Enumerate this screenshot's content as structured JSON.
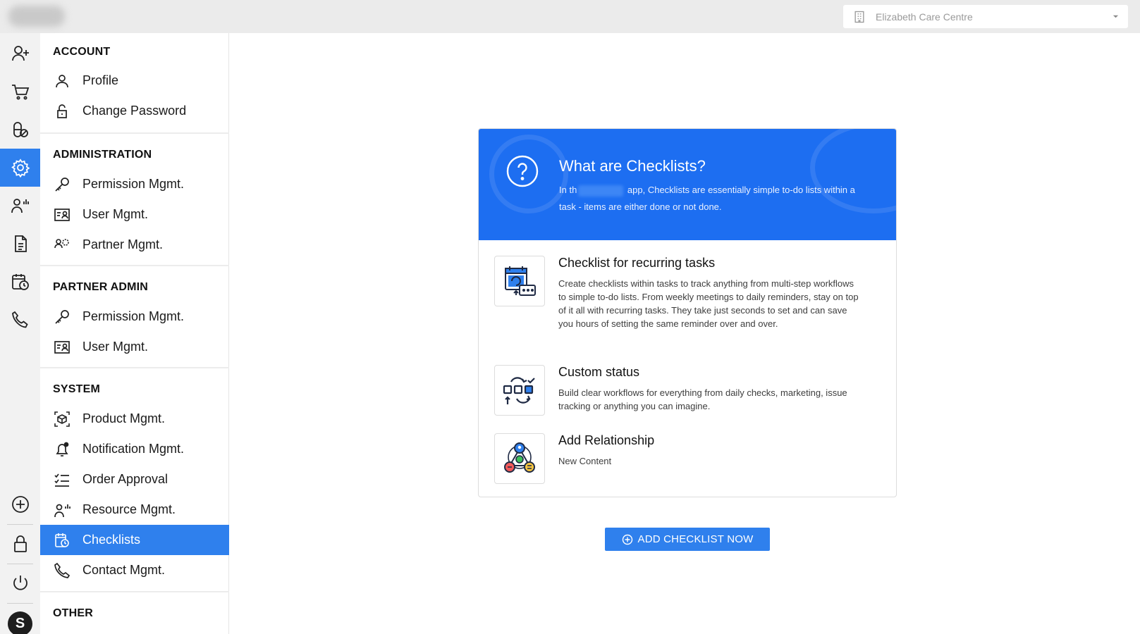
{
  "header": {
    "facility_name": "Elizabeth Care Centre",
    "facility_icon": "building-icon",
    "dropdown_icon": "caret-down-icon"
  },
  "rail": {
    "items": [
      "add-user-icon",
      "cart-icon",
      "medication-icon",
      "settings-icon",
      "resource-icon",
      "document-icon",
      "calendar-clock-icon",
      "phone-icon"
    ],
    "bottom_items": [
      "plus-circle-icon",
      "lock-icon",
      "power-icon"
    ],
    "avatar_initial": "S",
    "accent": "#2f80ed"
  },
  "sidebar": {
    "sections": [
      {
        "title": "ACCOUNT",
        "items": [
          {
            "label": "Profile",
            "icon": "user-icon"
          },
          {
            "label": "Change Password",
            "icon": "unlock-icon"
          }
        ]
      },
      {
        "title": "ADMINISTRATION",
        "items": [
          {
            "label": "Permission Mgmt.",
            "icon": "key-icon"
          },
          {
            "label": "User Mgmt.",
            "icon": "id-card-icon"
          },
          {
            "label": "Partner Mgmt.",
            "icon": "partner-icon"
          }
        ]
      },
      {
        "title": "PARTNER ADMIN",
        "items": [
          {
            "label": "Permission Mgmt.",
            "icon": "key-icon"
          },
          {
            "label": "User Mgmt.",
            "icon": "id-card-icon"
          }
        ]
      },
      {
        "title": "SYSTEM",
        "items": [
          {
            "label": "Product Mgmt.",
            "icon": "product-icon"
          },
          {
            "label": "Notification Mgmt.",
            "icon": "bell-icon"
          },
          {
            "label": "Order Approval",
            "icon": "checklist-icon"
          },
          {
            "label": "Resource Mgmt.",
            "icon": "resource-icon"
          },
          {
            "label": "Checklists",
            "icon": "calendar-clock-icon",
            "active": true
          },
          {
            "label": "Contact Mgmt.",
            "icon": "phone-icon"
          }
        ]
      },
      {
        "title": "OTHER",
        "items": []
      }
    ]
  },
  "card": {
    "head": {
      "title": "What are Checklists?",
      "body_prefix": "In th",
      "body_suffix": " app, Checklists are essentially simple to-do lists within a task - items are either done or not done.",
      "icon": "question-circle-icon",
      "color": "#1d6ef1"
    },
    "features": [
      {
        "title": "Checklist for recurring tasks",
        "description": "Create checklists within tasks to track anything from multi-step workflows to simple to-do lists. From weekly meetings to daily reminders, stay on top of it all with recurring tasks. They take just seconds to set and can save you hours of setting the same reminder over and over.",
        "icon": "recurring-calendar-icon"
      },
      {
        "title": "Custom status",
        "description": "Build clear workflows for everything from daily checks, marketing, issue tracking or anything you can imagine.",
        "icon": "workflow-status-icon"
      },
      {
        "title": "Add Relationship",
        "description": "New Content",
        "icon": "relationship-icon"
      }
    ]
  },
  "cta": {
    "label": "ADD CHECKLIST NOW",
    "icon": "plus-circle-icon"
  }
}
